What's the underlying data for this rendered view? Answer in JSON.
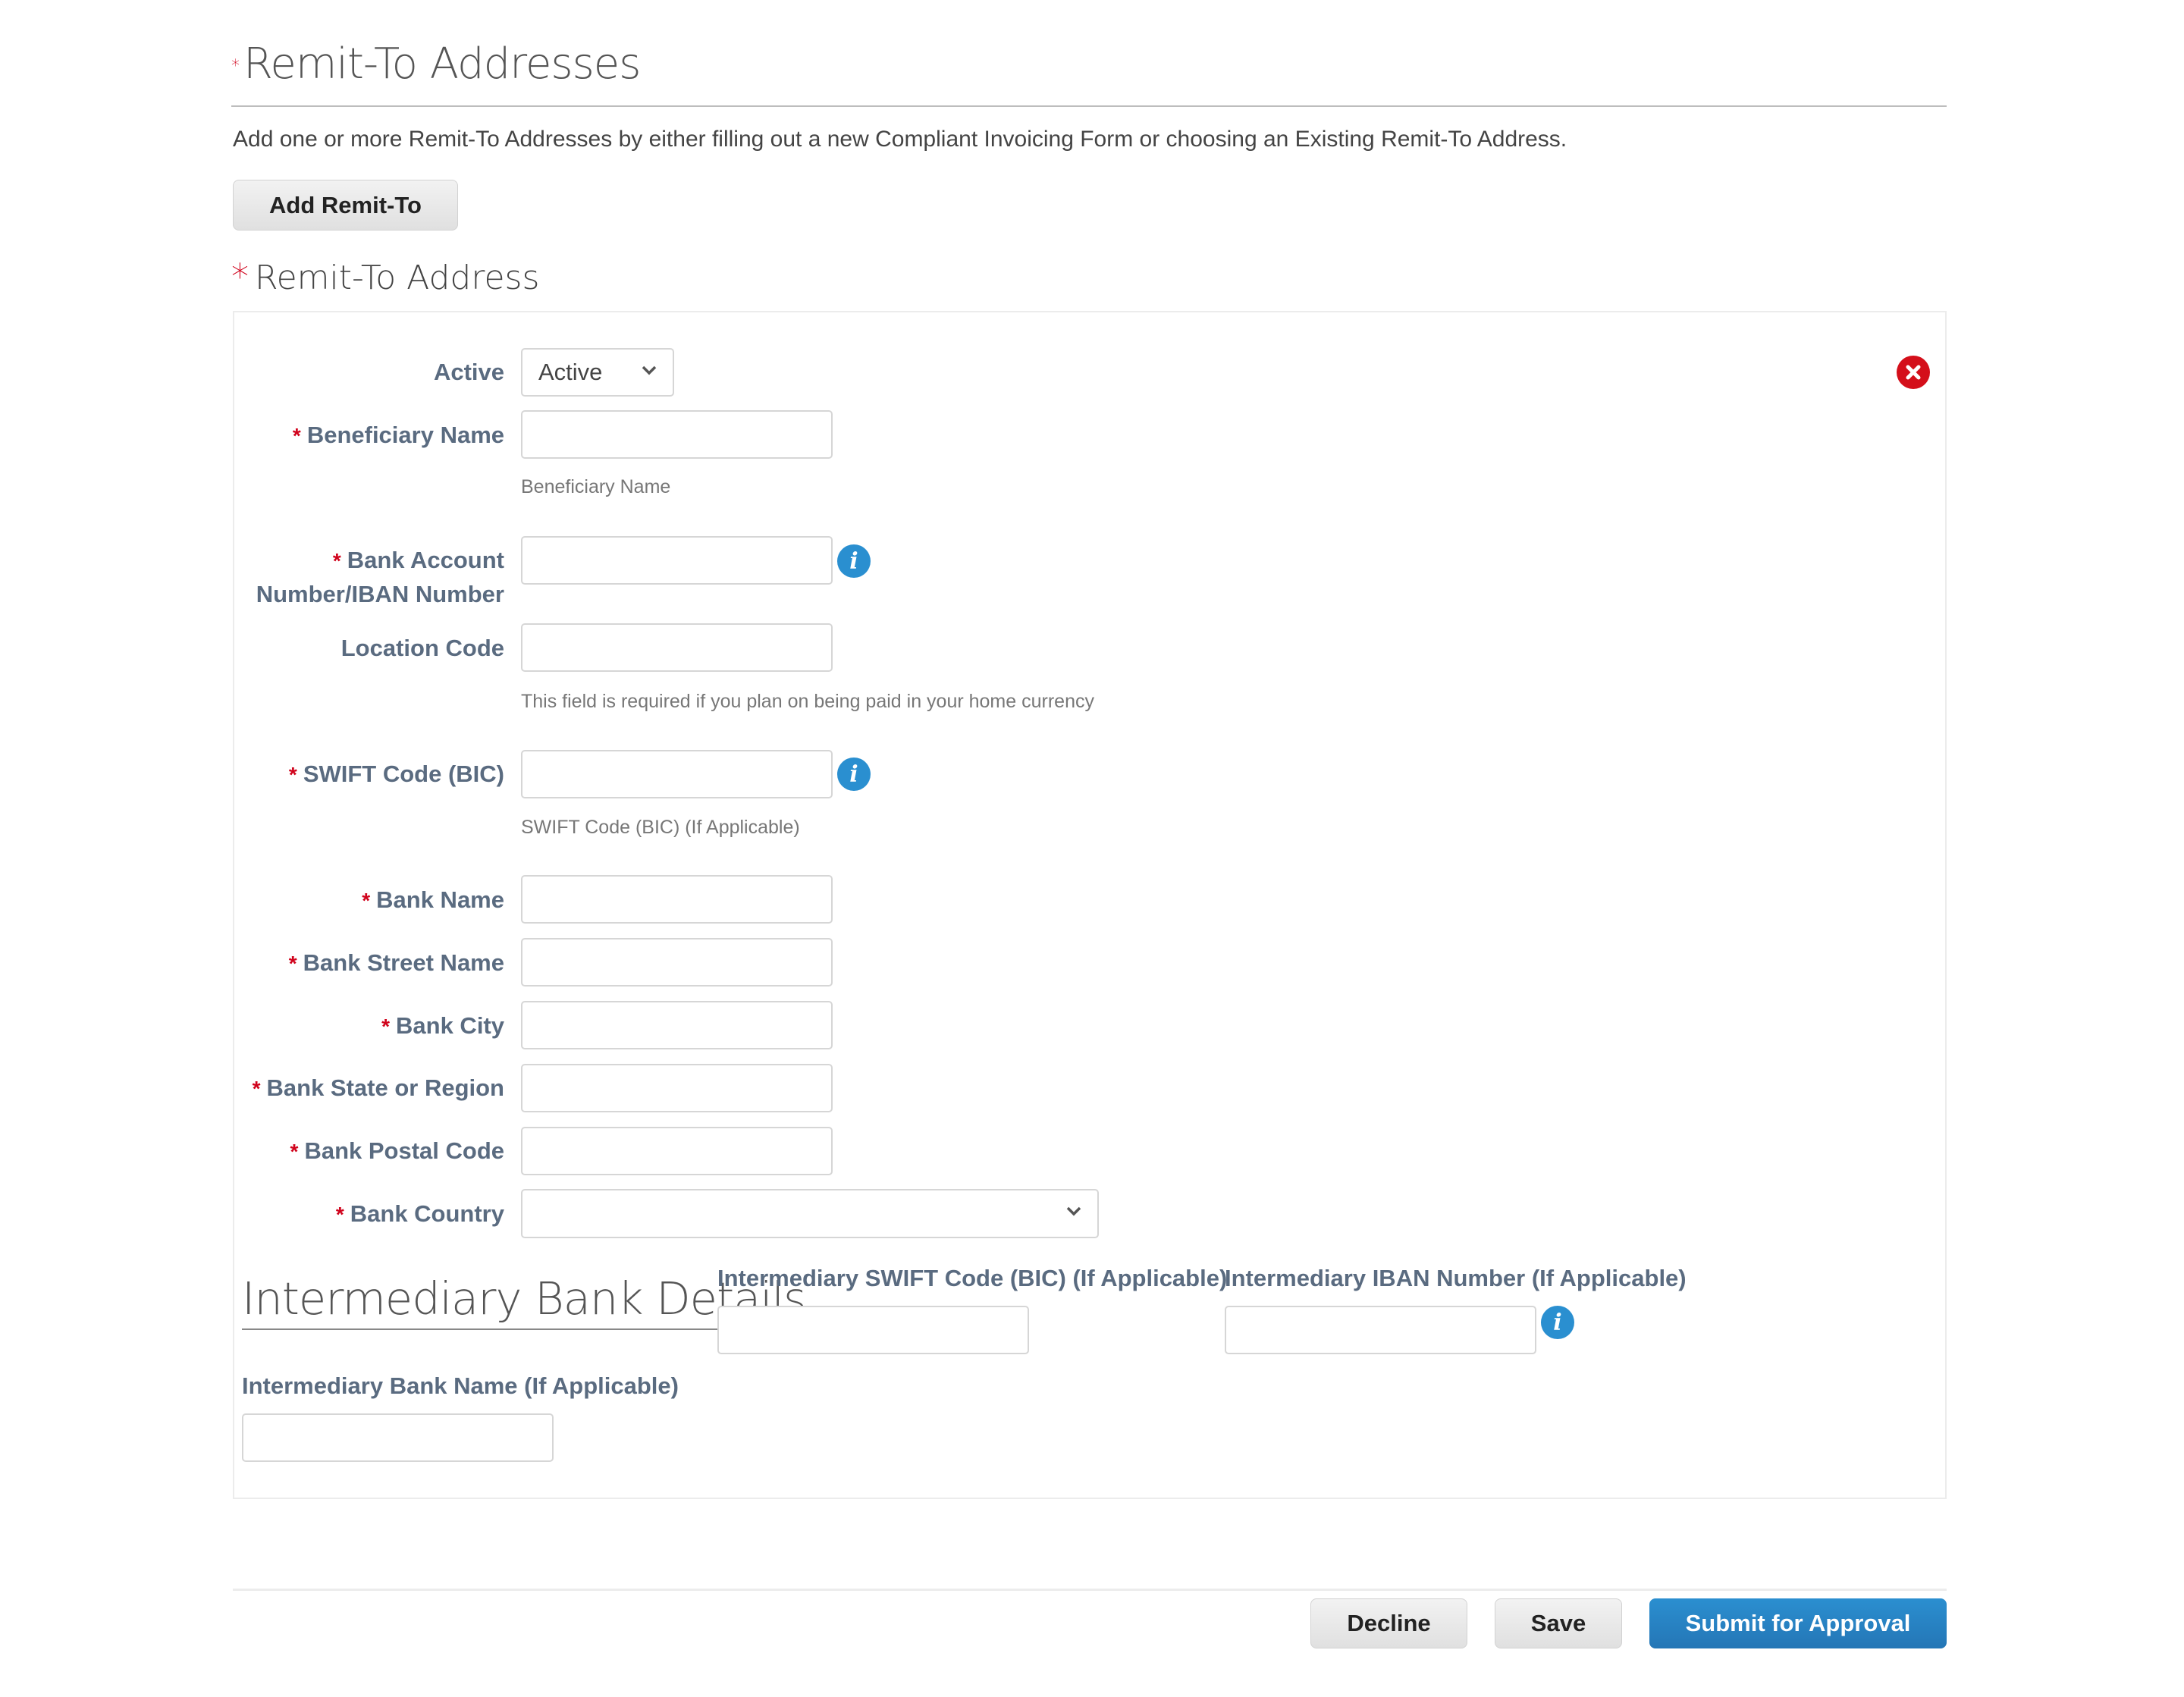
{
  "header": {
    "title": "Remit-To Addresses",
    "required_mark": "*",
    "description": "Add one or more Remit-To Addresses by either filling out a new Compliant Invoicing Form or choosing an Existing Remit-To Address.",
    "add_button": "Add Remit-To"
  },
  "section": {
    "title": "Remit-To Address",
    "required_mark": "*"
  },
  "form": {
    "active": {
      "label": "Active",
      "value": "Active"
    },
    "beneficiary_name": {
      "label": "Beneficiary Name",
      "value": "",
      "help": "Beneficiary Name"
    },
    "bank_account": {
      "label_line1": "Bank Account",
      "label_line2": "Number/IBAN Number",
      "value": ""
    },
    "location_code": {
      "label": "Location Code",
      "value": "",
      "help": "This field is required if you plan on being paid in your home currency"
    },
    "swift_code": {
      "label": "SWIFT Code (BIC)",
      "value": "",
      "help": "SWIFT Code (BIC) (If Applicable)"
    },
    "bank_name": {
      "label": "Bank Name",
      "value": ""
    },
    "bank_street": {
      "label": "Bank Street Name",
      "value": ""
    },
    "bank_city": {
      "label": "Bank City",
      "value": ""
    },
    "bank_state": {
      "label": "Bank State or Region",
      "value": ""
    },
    "bank_postal": {
      "label": "Bank Postal Code",
      "value": ""
    },
    "bank_country": {
      "label": "Bank Country",
      "value": ""
    },
    "required_mark": "*",
    "info_glyph": "i"
  },
  "intermediary": {
    "title": "Intermediary Bank Details",
    "swift_label": "Intermediary SWIFT Code (BIC) (If Applicable)",
    "iban_label": "Intermediary IBAN Number (If Applicable)",
    "bank_name_label": "Intermediary Bank Name (If Applicable)"
  },
  "footer": {
    "decline": "Decline",
    "save": "Save",
    "submit": "Submit for Approval"
  },
  "colors": {
    "required": "#d0021b",
    "label": "#5a6b80",
    "primary": "#2a8fd0",
    "remove": "#d40f1a"
  }
}
